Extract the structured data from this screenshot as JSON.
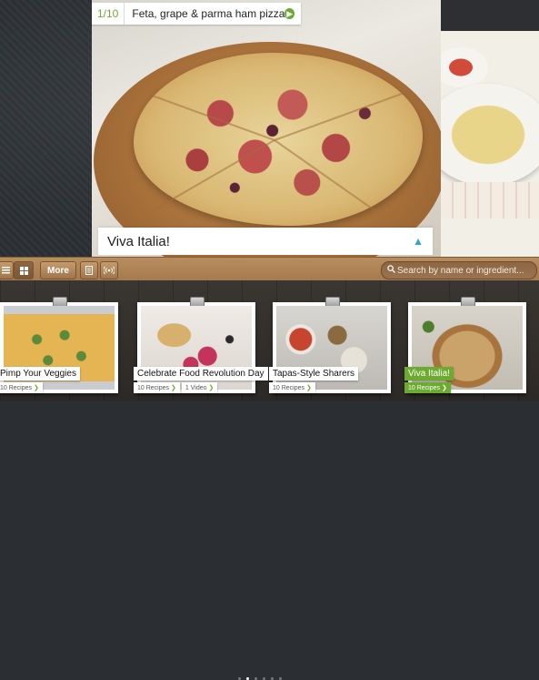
{
  "hero": {
    "counter": "1/10",
    "recipe_title": "Feta, grape & parma ham pizza",
    "collection_title": "Viva Italia!"
  },
  "toolbar": {
    "more_label": "More",
    "search_placeholder": "Search by name or ingredient..."
  },
  "collections": [
    {
      "title": "Pimp Your Veggies",
      "recipes": "10 Recipes",
      "video": "",
      "active": false
    },
    {
      "title": "Celebrate Food Revolution Day",
      "recipes": "10 Recipes",
      "video": "1 Video",
      "active": false
    },
    {
      "title": "Tapas-Style Sharers",
      "recipes": "10 Recipes",
      "video": "",
      "active": false
    },
    {
      "title": "Viva Italia!",
      "recipes": "10 Recipes",
      "video": "",
      "active": true
    }
  ],
  "pagination": {
    "pages": 6,
    "current": 1
  },
  "colors": {
    "accent_green": "#6cab2f",
    "accent_blue": "#28a5d3",
    "toolbar_wood": "#a47a4e"
  },
  "icons": {
    "list_view": "list-icon",
    "grid_view": "grid-icon",
    "notebook": "notebook-icon",
    "cast": "broadcast-icon",
    "search": "search-icon",
    "title_next": "arrow-right-circle-icon",
    "caption_toggle": "chevron-up-icon"
  }
}
